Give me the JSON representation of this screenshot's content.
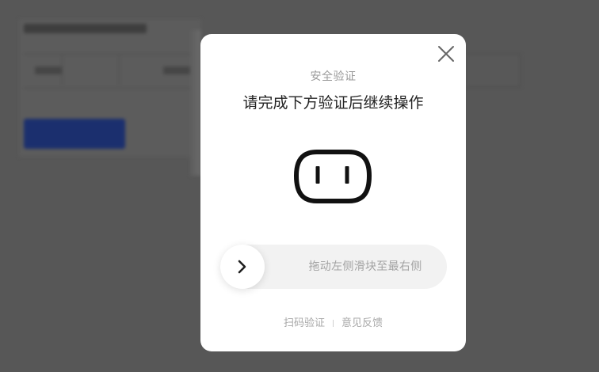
{
  "modal": {
    "subtitle": "安全验证",
    "title": "请完成下方验证后继续操作",
    "mascot_icon": "socket-face-icon",
    "close_icon": "close-icon",
    "slider": {
      "label": "拖动左侧滑块至最右侧",
      "handle_icon": "chevron-right-icon"
    },
    "footer": {
      "scan_link": "扫码验证",
      "feedback_link": "意见反馈"
    }
  },
  "colors": {
    "overlay": "#575757",
    "modal_bg": "#ffffff",
    "slider_track": "#f2f2f2",
    "title_text": "#222222",
    "muted_text": "#a3a3a3",
    "background_button": "#1b2f6e"
  }
}
